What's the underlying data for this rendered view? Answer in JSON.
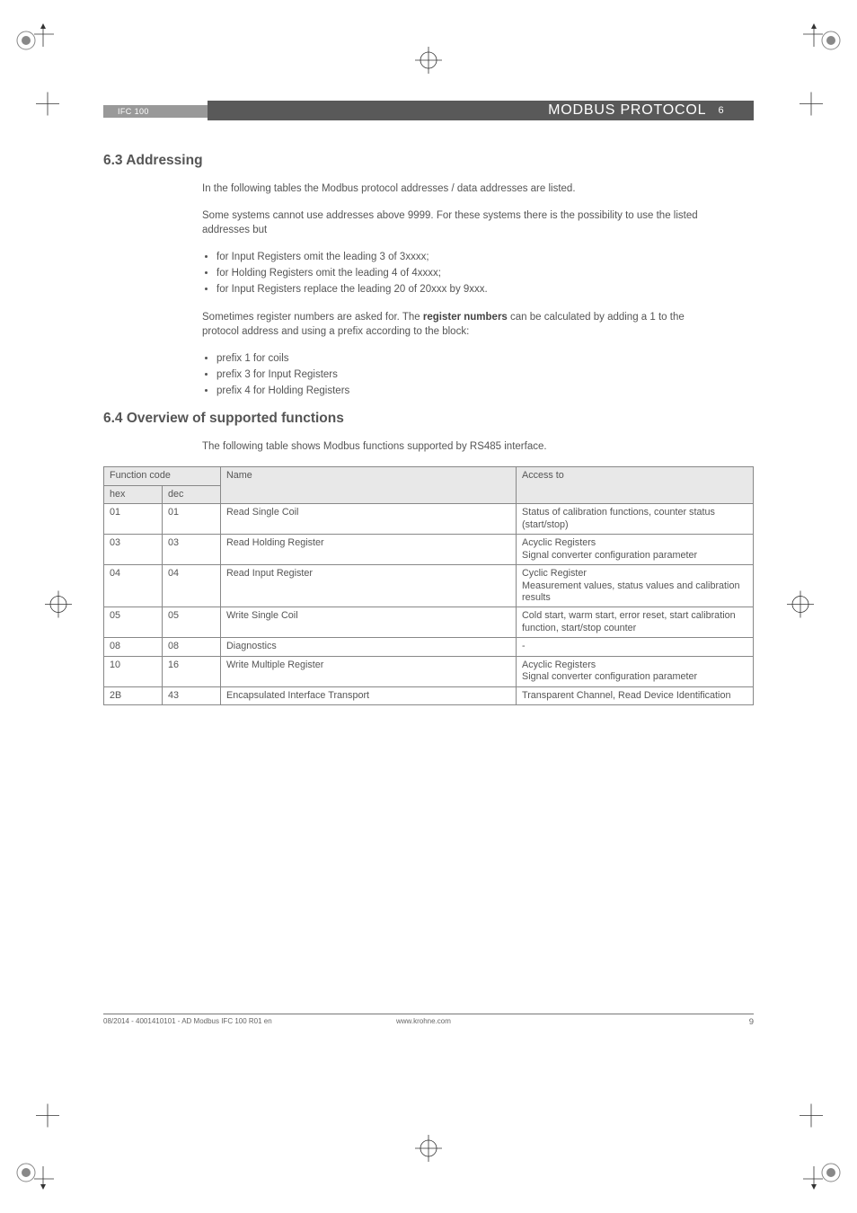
{
  "header": {
    "product": "IFC 100",
    "title": "MODBUS PROTOCOL",
    "section_box": "6"
  },
  "section63": {
    "heading": "6.3  Addressing",
    "p1": "In the following tables the Modbus protocol addresses / data addresses are listed.",
    "p2": "Some systems cannot use addresses above 9999. For these systems there is the possibility to use the listed addresses but",
    "bullets1": [
      "for Input Registers omit the leading 3 of 3xxxx;",
      "for Holding Registers omit the leading 4 of 4xxxx;",
      "for Input Registers replace the leading 20 of 20xxx by 9xxx."
    ],
    "p3a": "Sometimes register numbers are asked for. The ",
    "p3b": "register numbers",
    "p3c": " can be calculated by adding a 1 to the protocol address and using a prefix according to the block:",
    "bullets2": [
      "prefix 1 for coils",
      "prefix 3 for Input Registers",
      "prefix 4 for Holding Registers"
    ]
  },
  "section64": {
    "heading": "6.4  Overview of supported functions",
    "intro": "The following table shows Modbus functions supported by RS485 interface.",
    "cols": {
      "func": "Function code",
      "hex": "hex",
      "dec": "dec",
      "name": "Name",
      "access": "Access to"
    },
    "rows": [
      {
        "hex": "01",
        "dec": "01",
        "name": "Read Single Coil",
        "access": "Status of calibration functions, counter status (start/stop)"
      },
      {
        "hex": "03",
        "dec": "03",
        "name": "Read Holding Register",
        "access": "Acyclic Registers\nSignal converter configuration parameter"
      },
      {
        "hex": "04",
        "dec": "04",
        "name": "Read Input Register",
        "access": "Cyclic Register\nMeasurement values,  status values and calibration results"
      },
      {
        "hex": "05",
        "dec": "05",
        "name": "Write Single Coil",
        "access": "Cold start, warm start, error reset, start calibration function, start/stop counter"
      },
      {
        "hex": "08",
        "dec": "08",
        "name": "Diagnostics",
        "access": "-"
      },
      {
        "hex": "10",
        "dec": "16",
        "name": "Write Multiple Register",
        "access": "Acyclic Registers\nSignal converter configuration parameter"
      },
      {
        "hex": "2B",
        "dec": "43",
        "name": "Encapsulated Interface Transport",
        "access": "Transparent Channel, Read Device Identification"
      }
    ]
  },
  "footer": {
    "left": "08/2014 - 4001410101 - AD Modbus IFC 100 R01 en",
    "mid": "www.krohne.com",
    "right": "9"
  }
}
